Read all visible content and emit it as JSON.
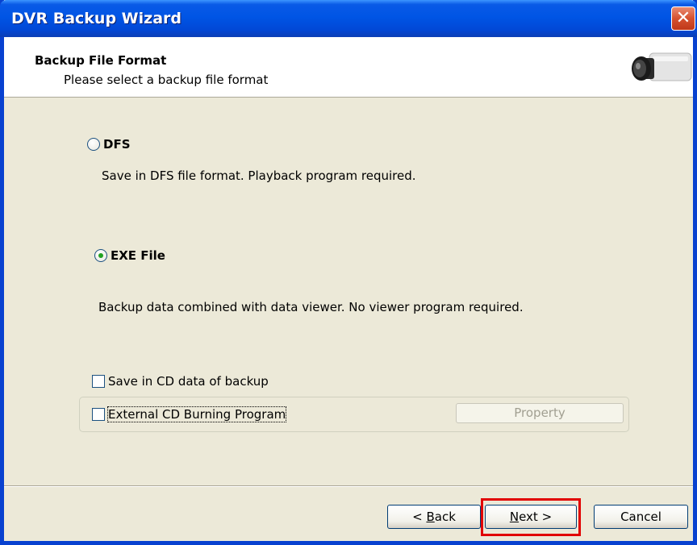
{
  "window": {
    "title": "DVR Backup Wizard",
    "close_symbol": "✕"
  },
  "header": {
    "title": "Backup File Format",
    "subtitle": "Please select a backup file format",
    "icon": "camera-icon"
  },
  "options": {
    "dfs": {
      "label": "DFS",
      "selected": false,
      "description": "Save in DFS file format. Playback program required."
    },
    "exe": {
      "label": "EXE File",
      "selected": true,
      "description": "Backup data combined with data viewer. No viewer program required."
    }
  },
  "checkboxes": {
    "save_cd": {
      "label": "Save in CD data of backup",
      "checked": false
    },
    "external_cd": {
      "label": "External CD Burning Program",
      "checked": false
    }
  },
  "property_button": {
    "label": "Property",
    "enabled": false
  },
  "footer": {
    "back_label_pre": "< ",
    "back_label_accel": "B",
    "back_label_post": "ack",
    "next_label_accel": "N",
    "next_label_post": "ext >",
    "cancel_label": "Cancel"
  },
  "colors": {
    "titlebar": "#0055e5",
    "dialog_bg": "#ece9d8",
    "highlight": "#e10000",
    "radio_dot": "#21a121"
  }
}
